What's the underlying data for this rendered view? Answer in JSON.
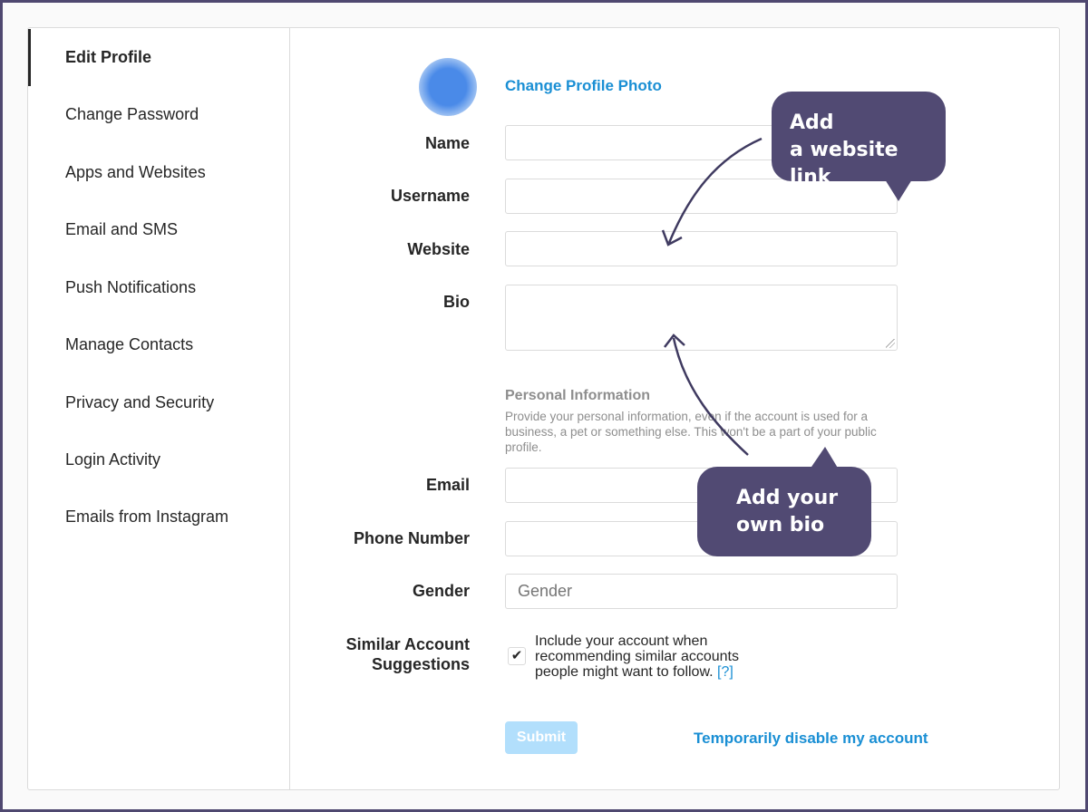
{
  "sidebar": {
    "items": [
      {
        "label": "Edit Profile",
        "active": true
      },
      {
        "label": "Change Password"
      },
      {
        "label": "Apps and Websites"
      },
      {
        "label": "Email and SMS"
      },
      {
        "label": "Push Notifications"
      },
      {
        "label": "Manage Contacts"
      },
      {
        "label": "Privacy and Security"
      },
      {
        "label": "Login Activity"
      },
      {
        "label": "Emails from Instagram"
      }
    ]
  },
  "profile": {
    "avatar_icon": "profile-photo",
    "change_photo_label": "Change Profile Photo"
  },
  "form": {
    "name": {
      "label": "Name",
      "value": ""
    },
    "username": {
      "label": "Username",
      "value": ""
    },
    "website": {
      "label": "Website",
      "value": ""
    },
    "bio": {
      "label": "Bio",
      "value": ""
    },
    "personal_info_title": "Personal Information",
    "personal_info_desc": "Provide your personal information, even if the account is used for a business, a pet or something else. This won't be a part of your public profile.",
    "email": {
      "label": "Email",
      "value": ""
    },
    "phone": {
      "label": "Phone Number",
      "value": ""
    },
    "gender": {
      "label": "Gender",
      "placeholder": "Gender"
    },
    "similar": {
      "label_line1": "Similar Account",
      "label_line2": "Suggestions",
      "checked": true,
      "check_glyph": "✔",
      "text": "Include your account when recommending similar accounts people might want to follow.",
      "help": "[?]"
    },
    "submit_label": "Submit",
    "disable_label": "Temporarily disable my account"
  },
  "annotations": {
    "callout_website_line1": "Add",
    "callout_website_line2": "a website link",
    "callout_bio_line1": "Add your",
    "callout_bio_line2": "own bio"
  },
  "colors": {
    "link": "#1a8fd4",
    "callout": "#514a73",
    "submit_disabled": "#b2dffc",
    "frame": "#4f4870"
  }
}
